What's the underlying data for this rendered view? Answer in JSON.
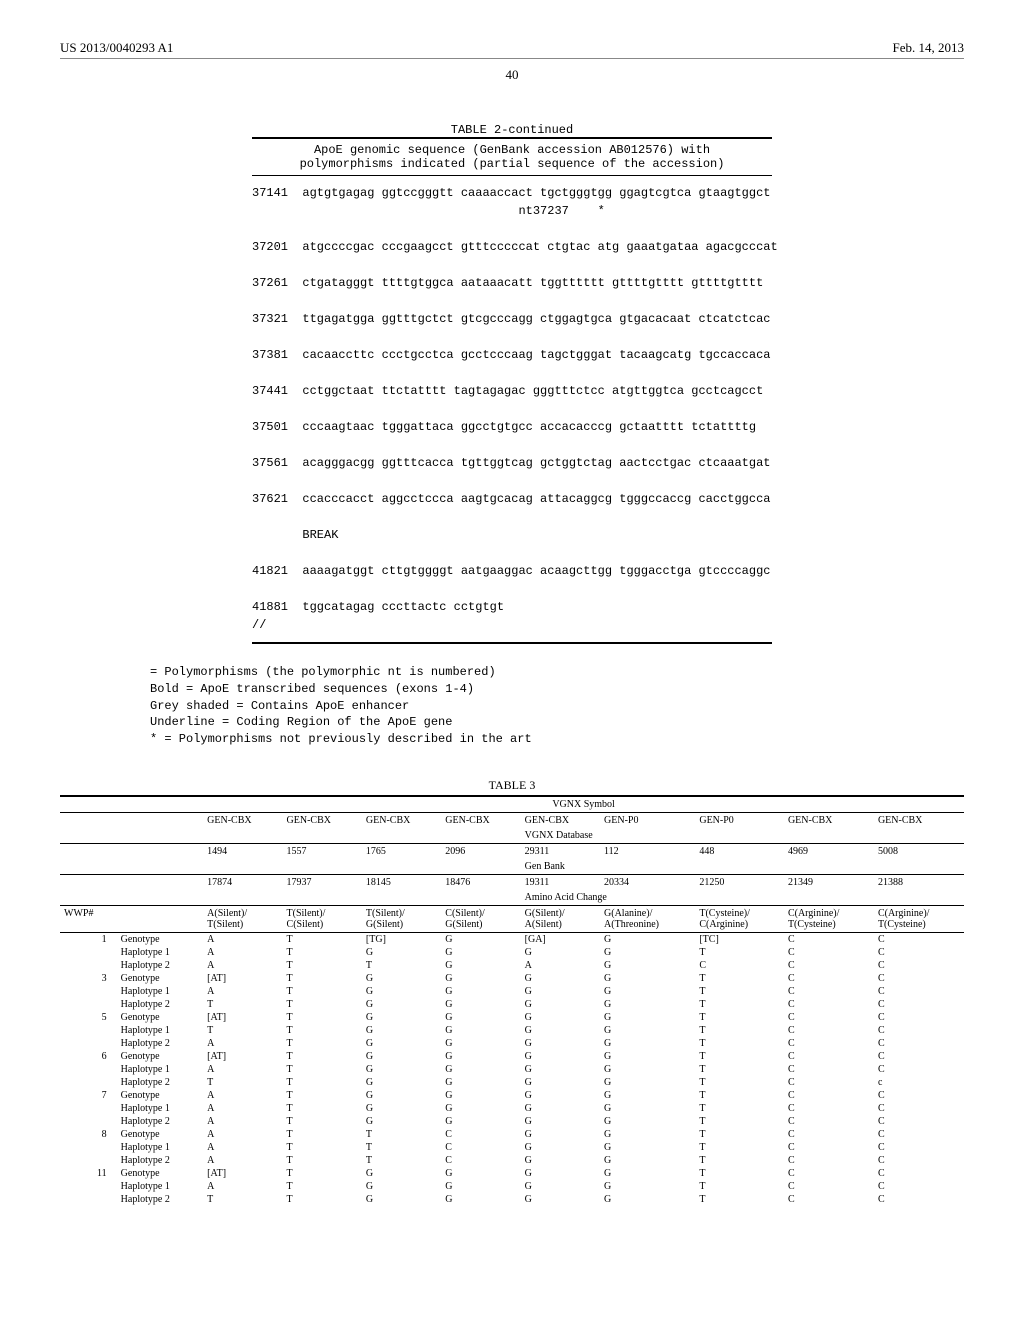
{
  "header": {
    "pub_number": "US 2013/0040293 A1",
    "pub_date": "Feb. 14, 2013",
    "page": "40"
  },
  "table2": {
    "title": "TABLE 2-continued",
    "subtitle": "ApoE genomic sequence (GenBank accession AB012576) with\npolymorphisms indicated (partial sequence of the accession)",
    "lines": [
      "37141  agtgtgagag ggtccgggtt caaaaccact tgctgggtgg ggagtcgtca gtaagtggct",
      "                                     nt37237    *",
      "",
      "37201  atgccccgac cccgaagcct gtttcccccat ctgtac atg gaaatgataa agacgcccat",
      "",
      "37261  ctgatagggt ttttgtggca aataaacatt tggtttttt gttttgtttt gttttgtttt",
      "",
      "37321  ttgagatgga ggtttgctct gtcgcccagg ctggagtgca gtgacacaat ctcatctcac",
      "",
      "37381  cacaaccttc ccctgcctca gcctcccaag tagctgggat tacaagcatg tgccaccaca",
      "",
      "37441  cctggctaat ttctatttt tagtagagac gggtttctcc atgttggtca gcctcagcct",
      "",
      "37501  cccaagtaac tgggattaca ggcctgtgcc accacacccg gctaatttt tctattttg",
      "",
      "37561  acagggacgg ggtttcacca tgttggtcag gctggtctag aactcctgac ctcaaatgat",
      "",
      "37621  ccacccacct aggcctccca aagtgcacag attacaggcg tgggccaccg cacctggcca",
      "",
      "       BREAK",
      "",
      "41821  aaaagatggt cttgtggggt aatgaaggac acaagcttgg tgggacctga gtccccaggc",
      "",
      "41881  tggcatagag cccttactc cctgtgt",
      "//"
    ],
    "legend": [
      "= Polymorphisms (the polymorphic nt is numbered)",
      "Bold = ApoE transcribed sequences (exons 1-4)",
      "Grey shaded = Contains ApoE enhancer",
      "Underline = Coding Region of the ApoE gene",
      "* = Polymorphisms not previously described in the art"
    ]
  },
  "table3": {
    "title": "TABLE 3",
    "symbol_header": "VGNX Symbol",
    "db_header": "VGNX Database",
    "gb_header": "Gen Bank",
    "aac_header": "Amino Acid Change",
    "wwp_header": "WWP#",
    "symbol_row": [
      "GEN-CBX",
      "GEN-CBX",
      "GEN-CBX",
      "GEN-CBX",
      "GEN-CBX",
      "GEN-P0",
      "GEN-P0",
      "GEN-CBX",
      "GEN-CBX"
    ],
    "db_row": [
      "1494",
      "1557",
      "1765",
      "2096",
      "29311",
      "112",
      "448",
      "4969",
      "5008"
    ],
    "gb_row": [
      "17874",
      "17937",
      "18145",
      "18476",
      "19311",
      "20334",
      "21250",
      "21349",
      "21388"
    ],
    "aac_row": [
      "A(Silent)/ T(Silent)",
      "T(Silent)/ C(Silent)",
      "T(Silent)/ G(Silent)",
      "C(Silent)/ G(Silent)",
      "G(Silent)/ A(Silent)",
      "G(Alanine)/ A(Threonine)",
      "T(Cysteine)/ C(Arginine)",
      "C(Arginine)/ T(Cysteine)",
      "C(Arginine)/ T(Cysteine)"
    ],
    "rows": [
      {
        "wwp": "1",
        "label": "Genotype",
        "v": [
          "A",
          "T",
          "[TG]",
          "G",
          "[GA]",
          "G",
          "[TC]",
          "C",
          "C"
        ]
      },
      {
        "wwp": "",
        "label": "Haplotype 1",
        "v": [
          "A",
          "T",
          "G",
          "G",
          "G",
          "G",
          "T",
          "C",
          "C"
        ]
      },
      {
        "wwp": "",
        "label": "Haplotype 2",
        "v": [
          "A",
          "T",
          "T",
          "G",
          "A",
          "G",
          "C",
          "C",
          "C"
        ]
      },
      {
        "wwp": "3",
        "label": "Genotype",
        "v": [
          "[AT]",
          "T",
          "G",
          "G",
          "G",
          "G",
          "T",
          "C",
          "C"
        ]
      },
      {
        "wwp": "",
        "label": "Haplotype 1",
        "v": [
          "A",
          "T",
          "G",
          "G",
          "G",
          "G",
          "T",
          "C",
          "C"
        ]
      },
      {
        "wwp": "",
        "label": "Haplotype 2",
        "v": [
          "T",
          "T",
          "G",
          "G",
          "G",
          "G",
          "T",
          "C",
          "C"
        ]
      },
      {
        "wwp": "5",
        "label": "Genotype",
        "v": [
          "[AT]",
          "T",
          "G",
          "G",
          "G",
          "G",
          "T",
          "C",
          "C"
        ]
      },
      {
        "wwp": "",
        "label": "Haplotype 1",
        "v": [
          "T",
          "T",
          "G",
          "G",
          "G",
          "G",
          "T",
          "C",
          "C"
        ]
      },
      {
        "wwp": "",
        "label": "Haplotype 2",
        "v": [
          "A",
          "T",
          "G",
          "G",
          "G",
          "G",
          "T",
          "C",
          "C"
        ]
      },
      {
        "wwp": "6",
        "label": "Genotype",
        "v": [
          "[AT]",
          "T",
          "G",
          "G",
          "G",
          "G",
          "T",
          "C",
          "C"
        ]
      },
      {
        "wwp": "",
        "label": "Haplotype 1",
        "v": [
          "A",
          "T",
          "G",
          "G",
          "G",
          "G",
          "T",
          "C",
          "C"
        ]
      },
      {
        "wwp": "",
        "label": "Haplotype 2",
        "v": [
          "T",
          "T",
          "G",
          "G",
          "G",
          "G",
          "T",
          "C",
          "c"
        ]
      },
      {
        "wwp": "7",
        "label": "Genotype",
        "v": [
          "A",
          "T",
          "G",
          "G",
          "G",
          "G",
          "T",
          "C",
          "C"
        ]
      },
      {
        "wwp": "",
        "label": "Haplotype 1",
        "v": [
          "A",
          "T",
          "G",
          "G",
          "G",
          "G",
          "T",
          "C",
          "C"
        ]
      },
      {
        "wwp": "",
        "label": "Haplotype 2",
        "v": [
          "A",
          "T",
          "G",
          "G",
          "G",
          "G",
          "T",
          "C",
          "C"
        ]
      },
      {
        "wwp": "8",
        "label": "Genotype",
        "v": [
          "A",
          "T",
          "T",
          "C",
          "G",
          "G",
          "T",
          "C",
          "C"
        ]
      },
      {
        "wwp": "",
        "label": "Haplotype 1",
        "v": [
          "A",
          "T",
          "T",
          "C",
          "G",
          "G",
          "T",
          "C",
          "C"
        ]
      },
      {
        "wwp": "",
        "label": "Haplotype 2",
        "v": [
          "A",
          "T",
          "T",
          "C",
          "G",
          "G",
          "T",
          "C",
          "C"
        ]
      },
      {
        "wwp": "11",
        "label": "Genotype",
        "v": [
          "[AT]",
          "T",
          "G",
          "G",
          "G",
          "G",
          "T",
          "C",
          "C"
        ]
      },
      {
        "wwp": "",
        "label": "Haplotype 1",
        "v": [
          "A",
          "T",
          "G",
          "G",
          "G",
          "G",
          "T",
          "C",
          "C"
        ]
      },
      {
        "wwp": "",
        "label": "Haplotype 2",
        "v": [
          "T",
          "T",
          "G",
          "G",
          "G",
          "G",
          "T",
          "C",
          "C"
        ]
      }
    ]
  }
}
